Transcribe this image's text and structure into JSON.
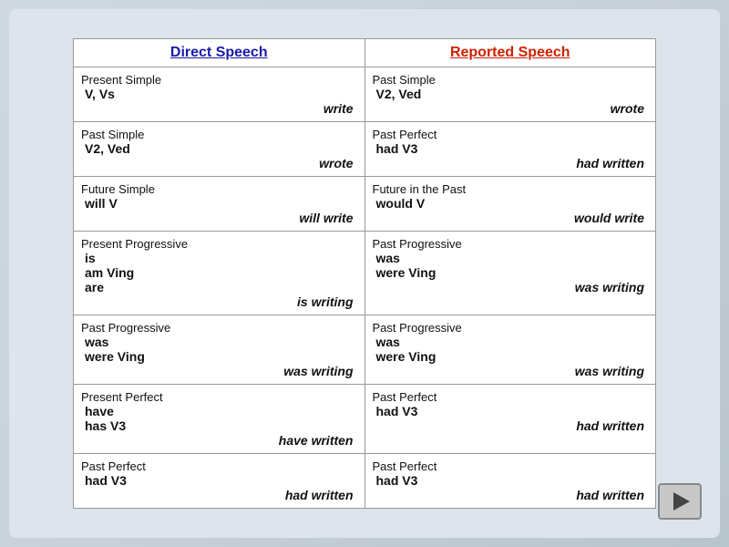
{
  "headers": {
    "direct": "Direct Speech",
    "reported": "Reported Speech"
  },
  "rows": [
    {
      "direct_tense": "Present Simple",
      "direct_form": "V, Vs",
      "direct_example": "write",
      "reported_tense": "Past Simple",
      "reported_form": "V2, Ved",
      "reported_example": "wrote"
    },
    {
      "direct_tense": "Past Simple",
      "direct_form": "V2, Ved",
      "direct_example": "wrote",
      "reported_tense": "Past Perfect",
      "reported_form": "had V3",
      "reported_example": "had written"
    },
    {
      "direct_tense": "Future Simple",
      "direct_form": "will V",
      "direct_example": "will write",
      "reported_tense": "Future in the Past",
      "reported_form": "would V",
      "reported_example": "would write"
    },
    {
      "direct_tense": "Present Progressive",
      "direct_form": "is\nam  Ving\nare",
      "direct_example": "is writing",
      "reported_tense": "Past Progressive",
      "reported_form": "was\nwere  Ving",
      "reported_example": "was writing"
    },
    {
      "direct_tense": "Past Progressive",
      "direct_form": "was\nwere  Ving",
      "direct_example": "was writing",
      "reported_tense": "Past Progressive",
      "reported_form": "was\nwere  Ving",
      "reported_example": "was writing"
    },
    {
      "direct_tense": "Present Perfect",
      "direct_form": "have\nhas   V3",
      "direct_example": "have written",
      "reported_tense": "Past Perfect",
      "reported_form": "had  V3",
      "reported_example": "had written"
    },
    {
      "direct_tense": "Past Perfect",
      "direct_form": "had  V3",
      "direct_example": "had written",
      "reported_tense": "Past Perfect",
      "reported_form": "had  V3",
      "reported_example": "had written"
    }
  ],
  "play_button_label": "▶"
}
